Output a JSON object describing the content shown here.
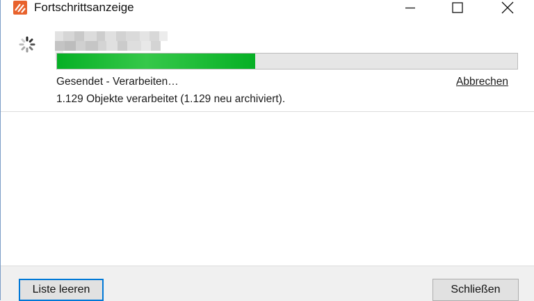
{
  "window": {
    "title": "Fortschrittsanzeige",
    "icons": {
      "app": "app-icon",
      "minimize": "minimize-icon",
      "maximize": "maximize-icon",
      "close": "close-icon"
    }
  },
  "progress": {
    "spinner_icon": "loading-spinner-icon",
    "fraction": 0.43,
    "status": "Gesendet - Verarbeiten…",
    "cancel_label": "Abbrechen",
    "detail": "1.129 Objekte verarbeitet (1.129 neu archiviert)."
  },
  "footer": {
    "clear_label": "Liste leeren",
    "close_label": "Schließen"
  },
  "colors": {
    "progress_fill": "#06b025",
    "app_icon": "#e8622c",
    "focus_border": "#0078d7"
  }
}
